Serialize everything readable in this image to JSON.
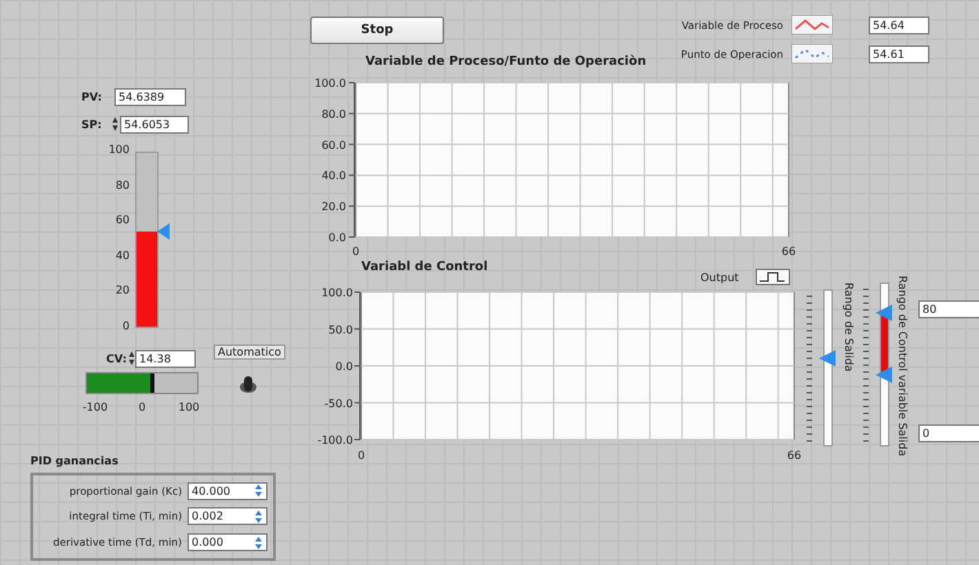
{
  "stop_button": {
    "label": "Stop"
  },
  "legend": [
    {
      "name": "Variable de Proceso",
      "value": "54.64",
      "kind": "solid",
      "color": "#e05a5a"
    },
    {
      "name": "Punto de Operacion",
      "value": "54.61",
      "kind": "dotted",
      "color": "#5a8ae0"
    }
  ],
  "process_chart": {
    "chart_data": {
      "type": "line",
      "grid": true,
      "title": "Variable de Proceso/Funto de Operaciòn",
      "xlim": [
        0,
        66
      ],
      "ylim": [
        0,
        100
      ],
      "xticks": [
        {
          "value": 0,
          "label": "0"
        },
        {
          "value": 66,
          "label": "66"
        }
      ],
      "yticks": [
        {
          "value": 100,
          "label": "100.0"
        },
        {
          "value": 80,
          "label": "80.0"
        },
        {
          "value": 60,
          "label": "60.0"
        },
        {
          "value": 40,
          "label": "40.0"
        },
        {
          "value": 20,
          "label": "20.0"
        },
        {
          "value": 0,
          "label": "0.0"
        }
      ]
    }
  },
  "control_chart": {
    "output_label": "Output",
    "chart_data": {
      "type": "line",
      "grid": true,
      "title": "Variabl de Control",
      "xlim": [
        0,
        66
      ],
      "ylim": [
        -100,
        100
      ],
      "xticks": [
        {
          "value": 0,
          "label": "0"
        },
        {
          "value": 66,
          "label": "66"
        }
      ],
      "yticks": [
        {
          "value": 100,
          "label": "100.0"
        },
        {
          "value": 50,
          "label": "50.0"
        },
        {
          "value": 0,
          "label": "0.0"
        },
        {
          "value": -50,
          "label": "-50.0"
        },
        {
          "value": -100,
          "label": "-100.0"
        }
      ]
    }
  },
  "pv": {
    "label": "PV:",
    "value": "54.6389"
  },
  "sp": {
    "label": "SP:",
    "value": "54.6053"
  },
  "tank": {
    "level": 0.546,
    "setpoint": {
      "level": 0.546
    },
    "scale": [
      "100",
      "80",
      "60",
      "40",
      "20",
      "0"
    ]
  },
  "cv": {
    "label": "CV:",
    "value": "14.38",
    "level": 0.572,
    "scale": [
      "-100",
      "0",
      "100"
    ]
  },
  "mode_switch": {
    "label": "Automatico",
    "on": false
  },
  "output_range_slider": {
    "label": "Rango de Salida",
    "level": 0.56
  },
  "control_range_slider": {
    "label": "Rango de Control variable Salida",
    "upper": {
      "level": 0.82,
      "value": "80"
    },
    "lower": {
      "level": 0.44,
      "value": "0"
    }
  },
  "pid": {
    "title": "PID ganancias",
    "rows": [
      {
        "label": "proportional gain (Kc)",
        "value": "40.000"
      },
      {
        "label": "integral time (Ti, min)",
        "value": "0.002"
      },
      {
        "label": "derivative time (Td, min)",
        "value": "0.000"
      }
    ]
  }
}
